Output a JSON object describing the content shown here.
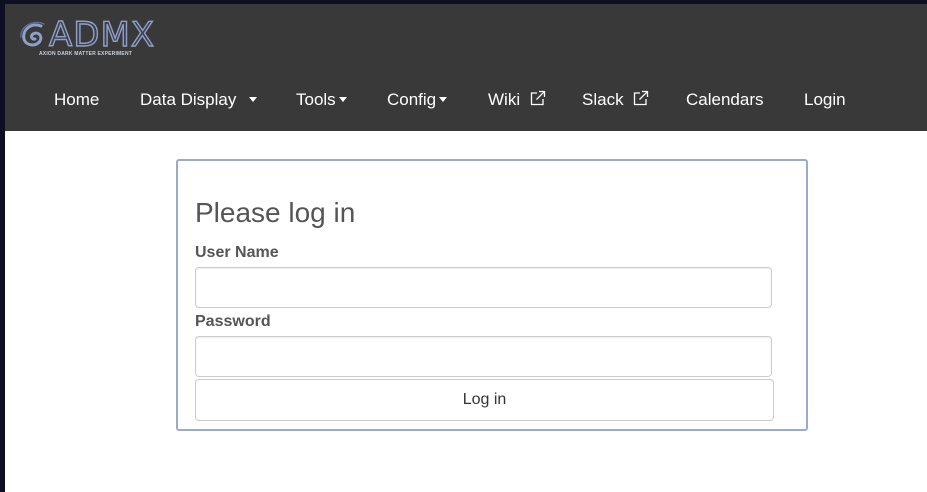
{
  "brand": {
    "logo_text": "ADMX",
    "logo_subtitle": "AXION DARK MATTER EXPERIMENT"
  },
  "nav": {
    "items": [
      {
        "label": "Home",
        "dropdown": false,
        "external": false
      },
      {
        "label": "Data Display",
        "dropdown": true,
        "external": false
      },
      {
        "label": "Tools",
        "dropdown": true,
        "external": false
      },
      {
        "label": "Config",
        "dropdown": true,
        "external": false
      },
      {
        "label": "Wiki",
        "dropdown": false,
        "external": true
      },
      {
        "label": "Slack",
        "dropdown": false,
        "external": true
      },
      {
        "label": "Calendars",
        "dropdown": false,
        "external": false
      },
      {
        "label": "Login",
        "dropdown": false,
        "external": false
      }
    ]
  },
  "login": {
    "title": "Please log in",
    "username_label": "User Name",
    "username_value": "",
    "password_label": "Password",
    "password_value": "",
    "submit_label": "Log in"
  },
  "colors": {
    "navbar_bg": "#393939",
    "panel_border": "#98acc9",
    "nav_text": "#ffffff",
    "label_text": "#555555"
  },
  "icons": {
    "dropdown": "caret-down-icon",
    "external": "external-link-icon"
  }
}
